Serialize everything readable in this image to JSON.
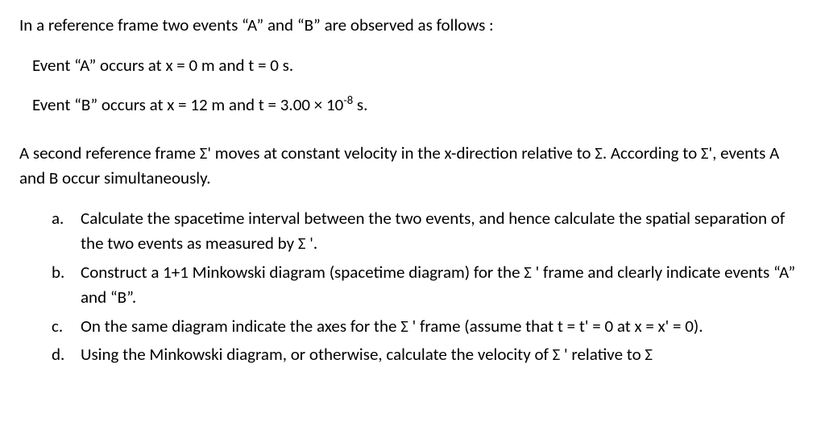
{
  "intro": "In a reference frame two events “A” and “B” are observed as follows :",
  "eventA": "Event “A” occurs at x = 0 m and t = 0 s.",
  "eventB_prefix": "Event “B” occurs at x = 12 m and t = 3.00 × 10",
  "eventB_exp": "-8",
  "eventB_suffix": " s.",
  "second_frame": "A second reference frame Σ' moves at constant velocity in the x-direction relative to Σ. According to Σ', events A and B occur simultaneously.",
  "items": {
    "a": {
      "letter": "a.",
      "text": "Calculate the spacetime interval between the two events, and hence calculate the spatial separation of the two events as measured by Σ '."
    },
    "b": {
      "letter": "b.",
      "text": "Construct a 1+1 Minkowski diagram (spacetime diagram) for the Σ ' frame and clearly indicate events “A” and “B”."
    },
    "c": {
      "letter": "c.",
      "text": "On the same diagram indicate the axes for the Σ ' frame (assume that t = t' = 0 at x = x' = 0)."
    },
    "d": {
      "letter": "d.",
      "text": "Using the Minkowski diagram, or otherwise, calculate the velocity of Σ ' relative to Σ"
    }
  }
}
